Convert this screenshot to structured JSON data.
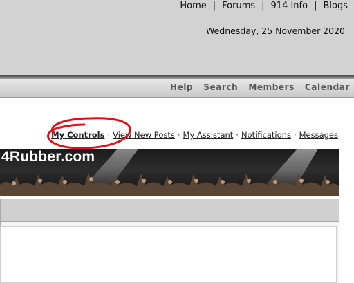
{
  "top_nav": {
    "items": [
      "Home",
      "Forums",
      "914 Info",
      "Blogs"
    ],
    "separator": "|"
  },
  "date_text": "Wednesday, 25 November 2020",
  "nav_bar": {
    "items": [
      "Help",
      "Search",
      "Members",
      "Calendar"
    ]
  },
  "user_links": {
    "items": [
      "My Controls",
      "View New Posts",
      "My Assistant",
      "Notifications",
      "Messages"
    ],
    "separator": "·"
  },
  "banner": {
    "title": "4Rubber.com"
  },
  "colors": {
    "header_bg": "#d2d2d2",
    "annotation": "#e0101a",
    "banner_bg": "#1b1b1b"
  },
  "icons": {
    "annotation": "hand-drawn-circle"
  }
}
